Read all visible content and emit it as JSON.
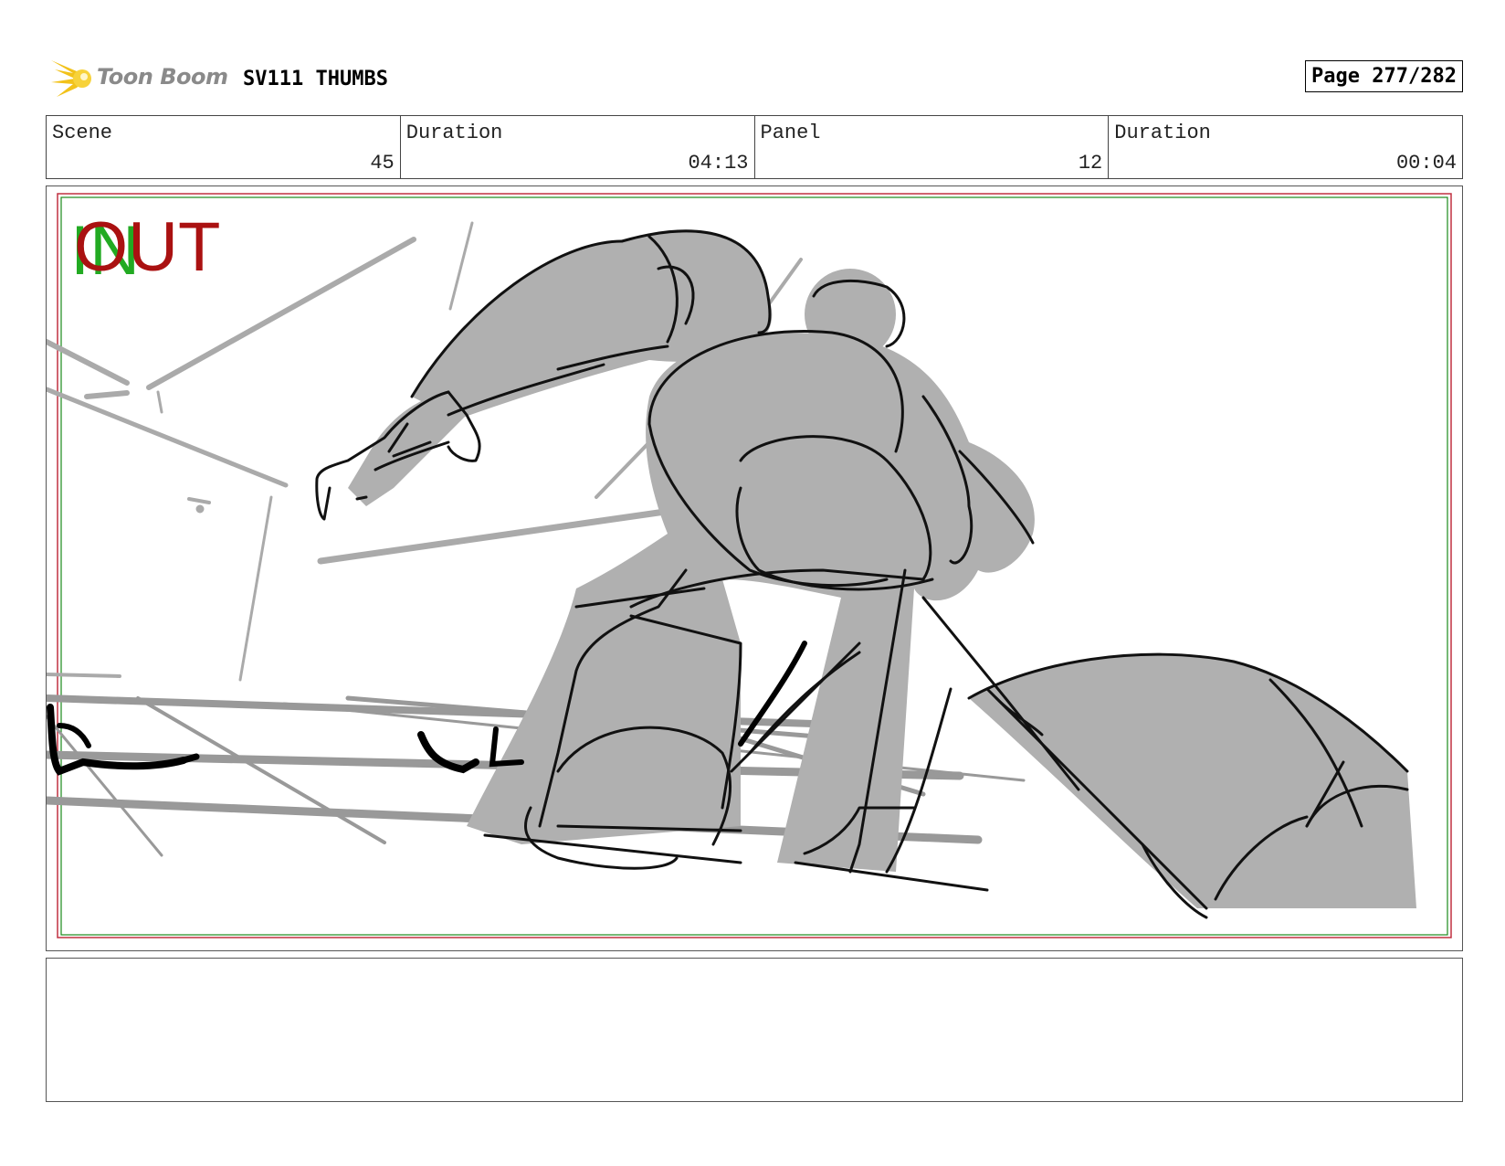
{
  "header": {
    "logo_text": "Toon Boom",
    "title": "SV111 THUMBS",
    "page": "Page 277/282"
  },
  "info": [
    {
      "label": "Scene",
      "value": "45"
    },
    {
      "label": "Duration",
      "value": "04:13"
    },
    {
      "label": "Panel",
      "value": "12"
    },
    {
      "label": "Duration",
      "value": "00:04"
    }
  ],
  "panel": {
    "in_marker": "IN",
    "out_marker": "OUT",
    "colors": {
      "in": "#22aa22",
      "out": "#aa1111",
      "fill": "#b0b0b0",
      "line": "#111111"
    }
  },
  "notes": {
    "text": ""
  }
}
